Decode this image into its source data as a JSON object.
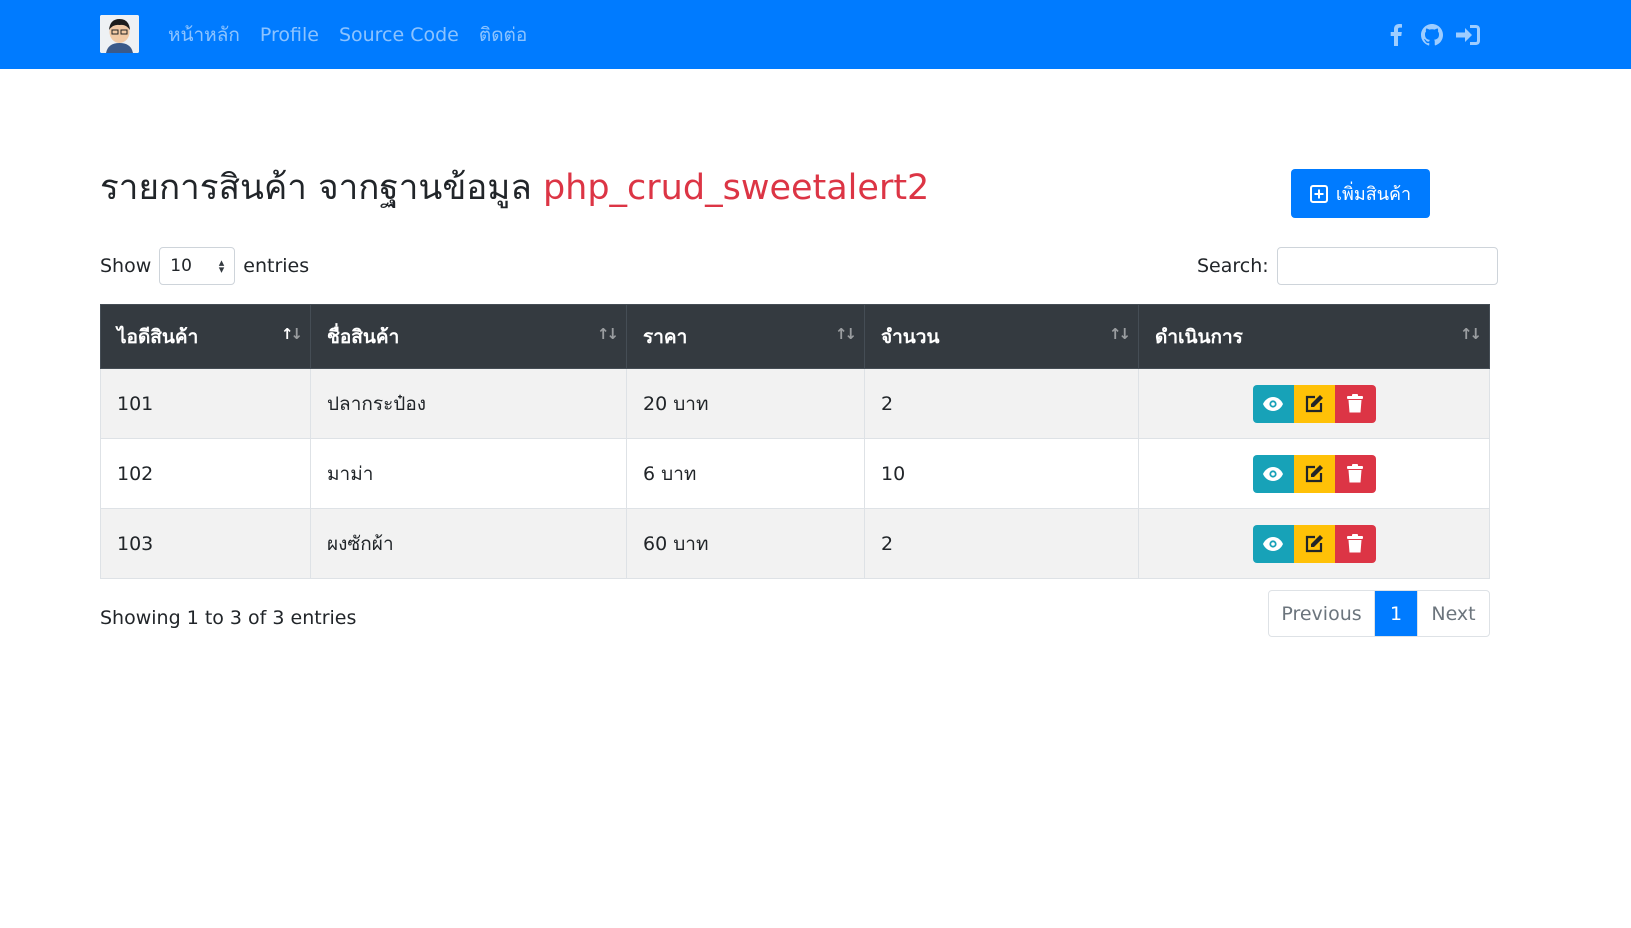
{
  "navbar": {
    "brand_alt": "avatar",
    "links": [
      "หน้าหลัก",
      "Profile",
      "Source Code",
      "ติดต่อ"
    ],
    "icons": [
      "facebook-icon",
      "github-icon",
      "sign-in-icon"
    ],
    "bg_color": "#007bff"
  },
  "heading": {
    "title": "รายการสินค้า จากฐานข้อมูล",
    "db_name": "php_crud_sweetalert2",
    "db_color": "#dc3545"
  },
  "add_button": {
    "label": "เพิ่มสินค้า",
    "icon": "plus-square-icon"
  },
  "length_control": {
    "show_label": "Show",
    "value": "10",
    "entries_label": "entries"
  },
  "search": {
    "label": "Search:",
    "value": ""
  },
  "table": {
    "columns": [
      "ไอดีสินค้า",
      "ชื่อสินค้า",
      "ราคา",
      "จำนวน",
      "ดำเนินการ"
    ],
    "rows": [
      {
        "id": "101",
        "name": "ปลากระป๋อง",
        "price": "20 บาท",
        "qty": "2"
      },
      {
        "id": "102",
        "name": "มาม่า",
        "price": "6 บาท",
        "qty": "10"
      },
      {
        "id": "103",
        "name": "ผงซักผ้า",
        "price": "60 บาท",
        "qty": "2"
      }
    ],
    "action_icons": [
      "eye-icon",
      "edit-icon",
      "trash-icon"
    ]
  },
  "footer": {
    "info": "Showing 1 to 3 of 3 entries",
    "prev_label": "Previous",
    "current_page": "1",
    "next_label": "Next"
  }
}
